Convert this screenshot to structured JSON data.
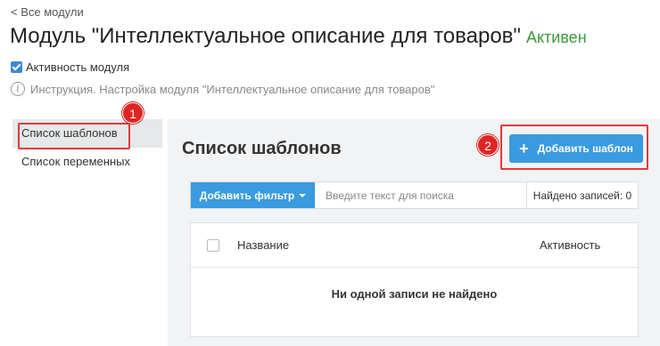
{
  "header": {
    "back_link": "< Все модули",
    "title": "Модуль \"Интеллектуальное описание для товаров\"",
    "status": "Активен",
    "activity_label": "Активность модуля",
    "instruction": "Инструкция. Настройка модуля \"Интеллектуальное описание для товаров\""
  },
  "sidebar": {
    "items": [
      {
        "label": "Список шаблонов"
      },
      {
        "label": "Список переменных"
      }
    ]
  },
  "main": {
    "title": "Список шаблонов",
    "add_button": "Добавить шаблон",
    "filter_button": "Добавить фильтр",
    "search_placeholder": "Введите текст для поиска",
    "records_found": "Найдено записей: 0"
  },
  "table": {
    "columns": [
      "Название",
      "Активность"
    ],
    "empty_message": "Ни одной записи не найдено"
  },
  "annotations": {
    "badges": [
      "1",
      "2"
    ]
  },
  "colors": {
    "accent": "#3a9be0",
    "status_active": "#3a9b3a",
    "callout": "#e02424"
  }
}
